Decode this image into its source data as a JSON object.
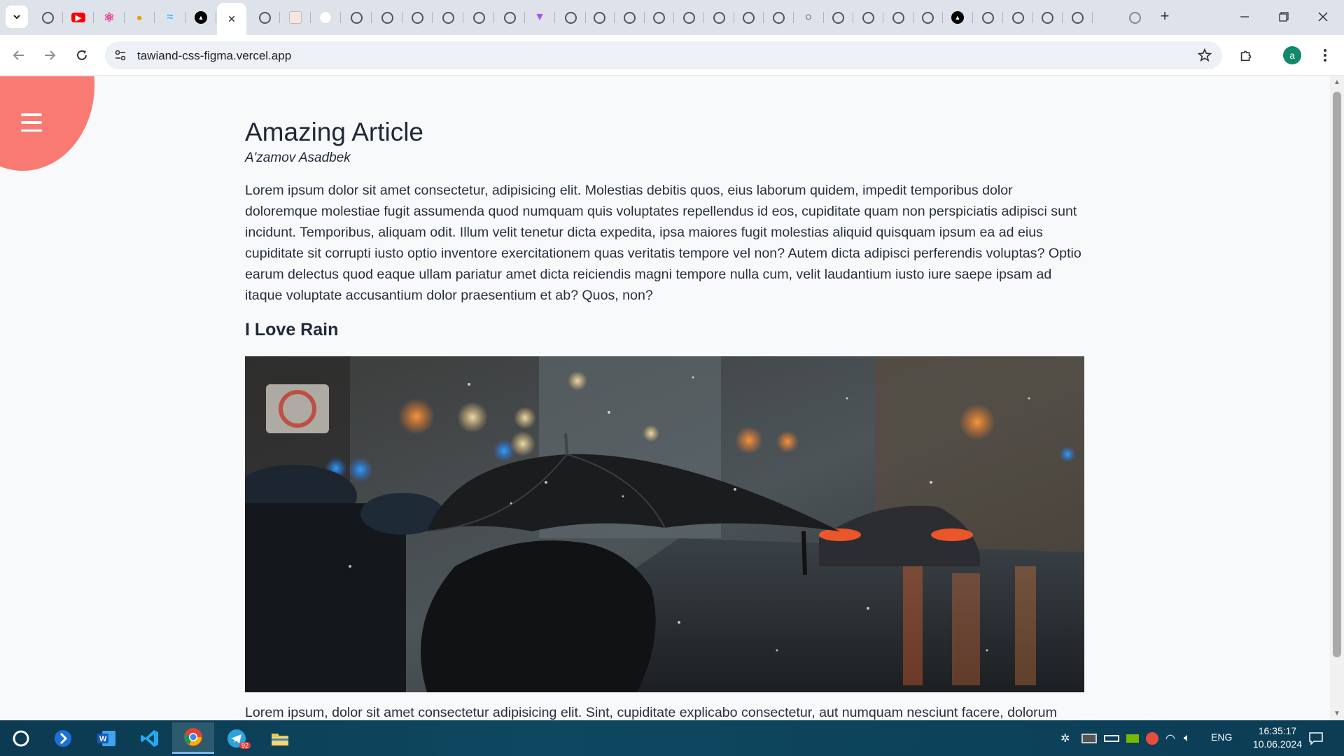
{
  "browser": {
    "active_tab_close": "✕",
    "new_tab": "+",
    "url": "tawiand-css-figma.vercel.app",
    "profile_initial": "a"
  },
  "article": {
    "title": "Amazing Article",
    "author": "A'zamov Asadbek",
    "paragraph1": "Lorem ipsum dolor sit amet consectetur, adipisicing elit. Molestias debitis quos, eius laborum quidem, impedit temporibus dolor doloremque molestiae fugit assumenda quod numquam quis voluptates repellendus id eos, cupiditate quam non perspiciatis adipisci sunt incidunt. Temporibus, aliquam odit. Illum velit tenetur dicta expedita, ipsa maiores fugit molestias aliquid quisquam ipsum ea ad eius cupiditate sit corrupti iusto optio inventore exercitationem quas veritatis tempore vel non? Autem dicta adipisci perferendis voluptas? Optio earum delectus quod eaque ullam pariatur amet dicta reiciendis magni tempore nulla cum, velit laudantium iusto iure saepe ipsam ad itaque voluptate accusantium dolor praesentium et ab? Quos, non?",
    "subheading": "I Love Rain",
    "paragraph2": "Lorem ipsum, dolor sit amet consectetur adipisicing elit. Sint, cupiditate explicabo consectetur, aut numquam nesciunt facere, dolorum"
  },
  "taskbar": {
    "lang": "ENG",
    "time": "16:35:17",
    "date": "10.06.2024",
    "telegram_badge": "92"
  },
  "colors": {
    "menu_blob": "#f97a73",
    "taskbar": "#0d4860"
  }
}
